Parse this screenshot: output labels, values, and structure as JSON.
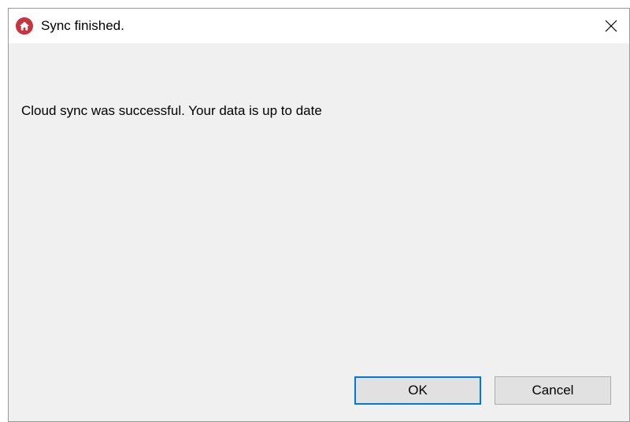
{
  "dialog": {
    "title": "Sync finished.",
    "app_icon": "home-icon",
    "close_icon": "close-icon",
    "message": "Cloud sync was successful. Your data is up to date",
    "ok_label": "OK",
    "cancel_label": "Cancel"
  },
  "colors": {
    "app_icon_bg": "#c7343f",
    "dialog_bg": "#f0f0f0",
    "titlebar_bg": "#ffffff",
    "default_button_border": "#0078d7",
    "button_bg": "#e1e1e1"
  }
}
